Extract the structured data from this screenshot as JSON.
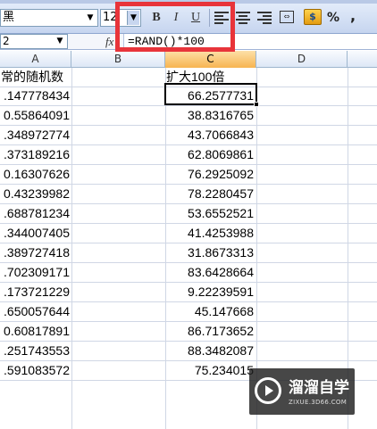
{
  "toolbar": {
    "font_name": "黑",
    "font_size": "12",
    "bold_label": "B",
    "italic_label": "I",
    "underline_label": "U",
    "currency_label": "$",
    "percent_label": "%",
    "comma_label": ","
  },
  "formula_bar": {
    "name_box": "2",
    "fx_label": "fx",
    "formula": "=RAND()*100"
  },
  "columns": [
    "A",
    "B",
    "C",
    "D"
  ],
  "active_column": "C",
  "headers": {
    "a": "常的随机数",
    "c": "扩大100倍"
  },
  "rows": [
    {
      "a": ".147778434",
      "c": "66.2577731"
    },
    {
      "a": "0.55864091",
      "c": "38.8316765"
    },
    {
      "a": ".348972774",
      "c": "43.7066843"
    },
    {
      "a": ".373189216",
      "c": "62.8069861"
    },
    {
      "a": "0.16307626",
      "c": "76.2925092"
    },
    {
      "a": "0.43239982",
      "c": "78.2280457"
    },
    {
      "a": ".688781234",
      "c": "53.6552521"
    },
    {
      "a": ".344007405",
      "c": "41.4253988"
    },
    {
      "a": ".389727418",
      "c": "31.8673313"
    },
    {
      "a": ".702309171",
      "c": "83.6428664"
    },
    {
      "a": ".173721229",
      "c": "9.22239591"
    },
    {
      "a": ".650057644",
      "c": "45.147668"
    },
    {
      "a": "0.60817891",
      "c": "86.7173652"
    },
    {
      "a": ".251743553",
      "c": "88.3482087"
    },
    {
      "a": ".591083572",
      "c": "75.234015"
    }
  ],
  "watermark": {
    "title": "溜溜自学",
    "subtitle": "ZIXUE.3D66.COM"
  },
  "colors": {
    "highlight": "#e8343a",
    "active_column": "#f7b451"
  }
}
